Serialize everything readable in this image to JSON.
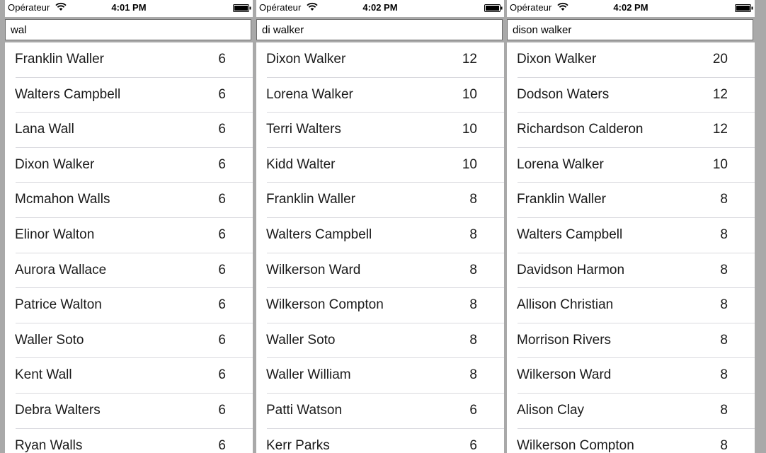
{
  "colors": {
    "background": "#a9a9a9",
    "panel": "#ffffff",
    "separator": "#d9d9de",
    "text": "#1a1a1a"
  },
  "screens": [
    {
      "carrier": "Opérateur",
      "time": "4:01 PM",
      "search_value": "wal",
      "rows": [
        {
          "name": "Franklin Waller",
          "count": "6"
        },
        {
          "name": "Walters Campbell",
          "count": "6"
        },
        {
          "name": "Lana Wall",
          "count": "6"
        },
        {
          "name": "Dixon Walker",
          "count": "6"
        },
        {
          "name": "Mcmahon Walls",
          "count": "6"
        },
        {
          "name": "Elinor Walton",
          "count": "6"
        },
        {
          "name": "Aurora Wallace",
          "count": "6"
        },
        {
          "name": "Patrice Walton",
          "count": "6"
        },
        {
          "name": "Waller Soto",
          "count": "6"
        },
        {
          "name": "Kent Wall",
          "count": "6"
        },
        {
          "name": "Debra Walters",
          "count": "6"
        },
        {
          "name": "Ryan Walls",
          "count": "6"
        }
      ]
    },
    {
      "carrier": "Opérateur",
      "time": "4:02 PM",
      "search_value": "di walker",
      "rows": [
        {
          "name": "Dixon Walker",
          "count": "12"
        },
        {
          "name": "Lorena Walker",
          "count": "10"
        },
        {
          "name": "Terri Walters",
          "count": "10"
        },
        {
          "name": "Kidd Walter",
          "count": "10"
        },
        {
          "name": "Franklin Waller",
          "count": "8"
        },
        {
          "name": "Walters Campbell",
          "count": "8"
        },
        {
          "name": "Wilkerson Ward",
          "count": "8"
        },
        {
          "name": "Wilkerson Compton",
          "count": "8"
        },
        {
          "name": "Waller Soto",
          "count": "8"
        },
        {
          "name": "Waller William",
          "count": "8"
        },
        {
          "name": "Patti Watson",
          "count": "6"
        },
        {
          "name": "Kerr Parks",
          "count": "6"
        }
      ]
    },
    {
      "carrier": "Opérateur",
      "time": "4:02 PM",
      "search_value": "dison walker",
      "rows": [
        {
          "name": "Dixon Walker",
          "count": "20"
        },
        {
          "name": "Dodson Waters",
          "count": "12"
        },
        {
          "name": "Richardson Calderon",
          "count": "12"
        },
        {
          "name": "Lorena Walker",
          "count": "10"
        },
        {
          "name": "Franklin Waller",
          "count": "8"
        },
        {
          "name": "Walters Campbell",
          "count": "8"
        },
        {
          "name": "Davidson Harmon",
          "count": "8"
        },
        {
          "name": "Allison Christian",
          "count": "8"
        },
        {
          "name": "Morrison Rivers",
          "count": "8"
        },
        {
          "name": "Wilkerson Ward",
          "count": "8"
        },
        {
          "name": "Alison Clay",
          "count": "8"
        },
        {
          "name": "Wilkerson Compton",
          "count": "8"
        }
      ]
    }
  ]
}
